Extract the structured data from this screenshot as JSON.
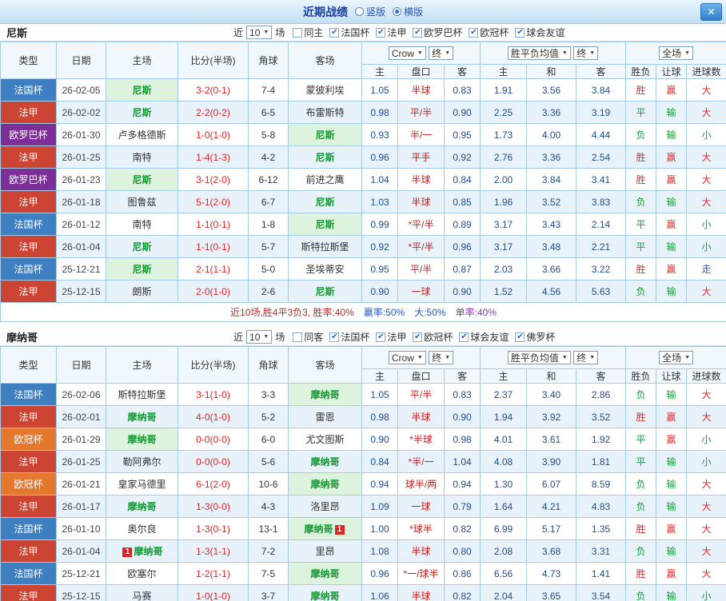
{
  "header": {
    "title": "近期战绩",
    "view_vertical": "竖版",
    "view_horizontal": "横版",
    "close_label": "✕"
  },
  "table": {
    "group_headers": [
      "类型",
      "日期",
      "主场",
      "比分(半场)",
      "角球",
      "客场"
    ],
    "sub_headers": [
      "主",
      "盘口",
      "客",
      "主",
      "和",
      "客",
      "胜负",
      "让球",
      "进球数"
    ],
    "selects": {
      "bookmaker": "Crow",
      "stage1": "终",
      "avg": "胜平负均值",
      "stage2": "终",
      "scope": "全场"
    },
    "near_label": "近",
    "games_count": "10",
    "games_suffix": "场"
  },
  "type_colors": {
    "法国杯": "#3d7fc1",
    "法甲": "#cc4433",
    "欧罗巴杯": "#7c3097",
    "欧冠杯": "#e4792e"
  },
  "result_colors": {
    "red": "#e02b2b",
    "green": "#13a039",
    "blue": "#2d5fd3"
  },
  "sections": [
    {
      "team": "尼斯",
      "checkboxes": [
        {
          "label": "同主",
          "checked": false
        },
        {
          "label": "法国杯",
          "checked": true
        },
        {
          "label": "法甲",
          "checked": true
        },
        {
          "label": "欧罗巴杯",
          "checked": true
        },
        {
          "label": "欧冠杯",
          "checked": true
        },
        {
          "label": "球会友谊",
          "checked": true
        }
      ],
      "rows": [
        {
          "type": "法国杯",
          "date": "26-02-05",
          "home": "尼斯",
          "home_team": true,
          "score": "3-2(0-1)",
          "corners": "7-4",
          "away": "蒙彼利埃",
          "away_team": false,
          "w_home": "1.05",
          "handicap": "半球",
          "w_away": "0.83",
          "avg_home": "1.91",
          "avg_draw": "3.56",
          "avg_away": "3.84",
          "outcome": {
            "t": "胜",
            "c": "red"
          },
          "let_result": {
            "t": "赢",
            "c": "red"
          },
          "goals": {
            "t": "大",
            "c": "red"
          }
        },
        {
          "type": "法甲",
          "date": "26-02-02",
          "home": "尼斯",
          "home_team": true,
          "score": "2-2(0-2)",
          "corners": "6-5",
          "away": "布雷斯特",
          "away_team": false,
          "w_home": "0.98",
          "handicap": "平/半",
          "w_away": "0.90",
          "avg_home": "2.25",
          "avg_draw": "3.36",
          "avg_away": "3.19",
          "outcome": {
            "t": "平",
            "c": "green"
          },
          "let_result": {
            "t": "输",
            "c": "green"
          },
          "goals": {
            "t": "大",
            "c": "red"
          }
        },
        {
          "type": "欧罗巴杯",
          "date": "26-01-30",
          "home": "卢多格德斯",
          "home_team": false,
          "score": "1-0(1-0)",
          "corners": "5-8",
          "away": "尼斯",
          "away_team": true,
          "w_home": "0.93",
          "handicap": "半/一",
          "w_away": "0.95",
          "avg_home": "1.73",
          "avg_draw": "4.00",
          "avg_away": "4.44",
          "outcome": {
            "t": "负",
            "c": "green"
          },
          "let_result": {
            "t": "输",
            "c": "green"
          },
          "goals": {
            "t": "小",
            "c": "green"
          }
        },
        {
          "type": "法甲",
          "date": "26-01-25",
          "home": "南特",
          "home_team": false,
          "score": "1-4(1-3)",
          "corners": "4-2",
          "away": "尼斯",
          "away_team": true,
          "w_home": "0.96",
          "handicap": "平手",
          "w_away": "0.92",
          "avg_home": "2.76",
          "avg_draw": "3.36",
          "avg_away": "2.54",
          "outcome": {
            "t": "胜",
            "c": "red"
          },
          "let_result": {
            "t": "赢",
            "c": "red"
          },
          "goals": {
            "t": "大",
            "c": "red"
          }
        },
        {
          "type": "欧罗巴杯",
          "date": "26-01-23",
          "home": "尼斯",
          "home_team": true,
          "score": "3-1(2-0)",
          "corners": "6-12",
          "away": "前进之鹰",
          "away_team": false,
          "w_home": "1.04",
          "handicap": "半球",
          "w_away": "0.84",
          "avg_home": "2.00",
          "avg_draw": "3.84",
          "avg_away": "3.41",
          "outcome": {
            "t": "胜",
            "c": "red"
          },
          "let_result": {
            "t": "赢",
            "c": "red"
          },
          "goals": {
            "t": "大",
            "c": "red"
          }
        },
        {
          "type": "法甲",
          "date": "26-01-18",
          "home": "图鲁兹",
          "home_team": false,
          "score": "5-1(2-0)",
          "corners": "6-7",
          "away": "尼斯",
          "away_team": true,
          "w_home": "1.03",
          "handicap": "半球",
          "w_away": "0.85",
          "avg_home": "1.96",
          "avg_draw": "3.52",
          "avg_away": "3.83",
          "outcome": {
            "t": "负",
            "c": "green"
          },
          "let_result": {
            "t": "输",
            "c": "green"
          },
          "goals": {
            "t": "大",
            "c": "red"
          }
        },
        {
          "type": "法国杯",
          "date": "26-01-12",
          "home": "南特",
          "home_team": false,
          "score": "1-1(0-1)",
          "corners": "1-8",
          "away": "尼斯",
          "away_team": true,
          "w_home": "0.99",
          "handicap": "*平/半",
          "w_away": "0.89",
          "avg_home": "3.17",
          "avg_draw": "3.43",
          "avg_away": "2.14",
          "outcome": {
            "t": "平",
            "c": "green"
          },
          "let_result": {
            "t": "赢",
            "c": "red"
          },
          "goals": {
            "t": "小",
            "c": "green"
          }
        },
        {
          "type": "法甲",
          "date": "26-01-04",
          "home": "尼斯",
          "home_team": true,
          "score": "1-1(0-1)",
          "corners": "5-7",
          "away": "斯特拉斯堡",
          "away_team": false,
          "w_home": "0.92",
          "handicap": "*平/半",
          "w_away": "0.96",
          "avg_home": "3.17",
          "avg_draw": "3.48",
          "avg_away": "2.21",
          "outcome": {
            "t": "平",
            "c": "green"
          },
          "let_result": {
            "t": "输",
            "c": "green"
          },
          "goals": {
            "t": "小",
            "c": "green"
          }
        },
        {
          "type": "法国杯",
          "date": "25-12-21",
          "home": "尼斯",
          "home_team": true,
          "score": "2-1(1-1)",
          "corners": "5-0",
          "away": "圣埃蒂安",
          "away_team": false,
          "w_home": "0.95",
          "handicap": "平/半",
          "w_away": "0.87",
          "avg_home": "2.03",
          "avg_draw": "3.66",
          "avg_away": "3.22",
          "outcome": {
            "t": "胜",
            "c": "red"
          },
          "let_result": {
            "t": "赢",
            "c": "red"
          },
          "goals": {
            "t": "走",
            "c": "blue"
          }
        },
        {
          "type": "法甲",
          "date": "25-12-15",
          "home": "朗斯",
          "home_team": false,
          "score": "2-0(1-0)",
          "corners": "2-6",
          "away": "尼斯",
          "away_team": true,
          "w_home": "0.90",
          "handicap": "一球",
          "w_away": "0.90",
          "avg_home": "1.52",
          "avg_draw": "4.56",
          "avg_away": "5.63",
          "outcome": {
            "t": "负",
            "c": "green"
          },
          "let_result": {
            "t": "输",
            "c": "green"
          },
          "goals": {
            "t": "大",
            "c": "red"
          }
        }
      ],
      "summary": [
        {
          "text": "近10场,胜4平3负3, 胜率:40%",
          "color": "#b03030"
        },
        {
          "text": "赢率:50%",
          "color": "#2757c4"
        },
        {
          "text": "大:50%",
          "color": "#2757c4"
        },
        {
          "text": "单率:40%",
          "color": "#9039b0"
        }
      ]
    },
    {
      "team": "摩纳哥",
      "checkboxes": [
        {
          "label": "同客",
          "checked": false
        },
        {
          "label": "法国杯",
          "checked": true
        },
        {
          "label": "法甲",
          "checked": true
        },
        {
          "label": "欧冠杯",
          "checked": true
        },
        {
          "label": "球会友谊",
          "checked": true
        },
        {
          "label": "佛罗杯",
          "checked": true
        }
      ],
      "rows": [
        {
          "type": "法国杯",
          "date": "26-02-06",
          "home": "斯特拉斯堡",
          "home_team": false,
          "score": "3-1(1-0)",
          "corners": "3-3",
          "away": "摩纳哥",
          "away_team": true,
          "w_home": "1.05",
          "handicap": "平/半",
          "w_away": "0.83",
          "avg_home": "2.37",
          "avg_draw": "3.40",
          "avg_away": "2.86",
          "outcome": {
            "t": "负",
            "c": "green"
          },
          "let_result": {
            "t": "输",
            "c": "green"
          },
          "goals": {
            "t": "大",
            "c": "red"
          }
        },
        {
          "type": "法甲",
          "date": "26-02-01",
          "home": "摩纳哥",
          "home_team": true,
          "score": "4-0(1-0)",
          "corners": "5-2",
          "away": "雷恩",
          "away_team": false,
          "w_home": "0.98",
          "handicap": "半球",
          "w_away": "0.90",
          "avg_home": "1.94",
          "avg_draw": "3.92",
          "avg_away": "3.52",
          "outcome": {
            "t": "胜",
            "c": "red"
          },
          "let_result": {
            "t": "赢",
            "c": "red"
          },
          "goals": {
            "t": "大",
            "c": "red"
          }
        },
        {
          "type": "欧冠杯",
          "date": "26-01-29",
          "home": "摩纳哥",
          "home_team": true,
          "score": "0-0(0-0)",
          "corners": "6-0",
          "away": "尤文图斯",
          "away_team": false,
          "w_home": "0.90",
          "handicap": "*半球",
          "w_away": "0.98",
          "avg_home": "4.01",
          "avg_draw": "3.61",
          "avg_away": "1.92",
          "outcome": {
            "t": "平",
            "c": "green"
          },
          "let_result": {
            "t": "赢",
            "c": "red"
          },
          "goals": {
            "t": "小",
            "c": "green"
          }
        },
        {
          "type": "法甲",
          "date": "26-01-25",
          "home": "勒阿弗尔",
          "home_team": false,
          "score": "0-0(0-0)",
          "corners": "5-6",
          "away": "摩纳哥",
          "away_team": true,
          "w_home": "0.84",
          "handicap": "*半/一",
          "w_away": "1.04",
          "avg_home": "4.08",
          "avg_draw": "3.90",
          "avg_away": "1.81",
          "outcome": {
            "t": "平",
            "c": "green"
          },
          "let_result": {
            "t": "输",
            "c": "green"
          },
          "goals": {
            "t": "小",
            "c": "green"
          }
        },
        {
          "type": "欧冠杯",
          "date": "26-01-21",
          "home": "皇家马德里",
          "home_team": false,
          "score": "6-1(2-0)",
          "corners": "10-6",
          "away": "摩纳哥",
          "away_team": true,
          "w_home": "0.94",
          "handicap": "球半/两",
          "w_away": "0.94",
          "avg_home": "1.30",
          "avg_draw": "6.07",
          "avg_away": "8.59",
          "outcome": {
            "t": "负",
            "c": "green"
          },
          "let_result": {
            "t": "输",
            "c": "green"
          },
          "goals": {
            "t": "大",
            "c": "red"
          }
        },
        {
          "type": "法甲",
          "date": "26-01-17",
          "home": "摩纳哥",
          "home_team": true,
          "score": "1-3(0-0)",
          "corners": "4-3",
          "away": "洛里昂",
          "away_team": false,
          "w_home": "1.09",
          "handicap": "一球",
          "w_away": "0.79",
          "avg_home": "1.64",
          "avg_draw": "4.21",
          "avg_away": "4.83",
          "outcome": {
            "t": "负",
            "c": "green"
          },
          "let_result": {
            "t": "输",
            "c": "green"
          },
          "goals": {
            "t": "大",
            "c": "red"
          }
        },
        {
          "type": "法国杯",
          "date": "26-01-10",
          "home": "奥尔良",
          "home_team": false,
          "score": "1-3(0-1)",
          "corners": "13-1",
          "away": "摩纳哥",
          "away_team": true,
          "away_card": "1",
          "w_home": "1.00",
          "handicap": "*球半",
          "w_away": "0.82",
          "avg_home": "6.99",
          "avg_draw": "5.17",
          "avg_away": "1.35",
          "outcome": {
            "t": "胜",
            "c": "red"
          },
          "let_result": {
            "t": "赢",
            "c": "red"
          },
          "goals": {
            "t": "大",
            "c": "red"
          }
        },
        {
          "type": "法甲",
          "date": "26-01-04",
          "home": "摩纳哥",
          "home_team": true,
          "home_card": "1",
          "score": "1-3(1-1)",
          "corners": "7-2",
          "away": "里昂",
          "away_team": false,
          "w_home": "1.08",
          "handicap": "半球",
          "w_away": "0.80",
          "avg_home": "2.08",
          "avg_draw": "3.68",
          "avg_away": "3.31",
          "outcome": {
            "t": "负",
            "c": "green"
          },
          "let_result": {
            "t": "输",
            "c": "green"
          },
          "goals": {
            "t": "大",
            "c": "red"
          }
        },
        {
          "type": "法国杯",
          "date": "25-12-21",
          "home": "欧塞尔",
          "home_team": false,
          "score": "1-2(1-1)",
          "corners": "7-5",
          "away": "摩纳哥",
          "away_team": true,
          "w_home": "0.96",
          "handicap": "*一/球半",
          "w_away": "0.86",
          "avg_home": "6.56",
          "avg_draw": "4.73",
          "avg_away": "1.41",
          "outcome": {
            "t": "胜",
            "c": "red"
          },
          "let_result": {
            "t": "赢",
            "c": "red"
          },
          "goals": {
            "t": "大",
            "c": "red"
          }
        },
        {
          "type": "法甲",
          "date": "25-12-15",
          "home": "马赛",
          "home_team": false,
          "score": "1-0(1-0)",
          "corners": "3-7",
          "away": "摩纳哥",
          "away_team": true,
          "w_home": "1.06",
          "handicap": "半球",
          "w_away": "0.82",
          "avg_home": "2.04",
          "avg_draw": "3.65",
          "avg_away": "3.54",
          "outcome": {
            "t": "负",
            "c": "green"
          },
          "let_result": {
            "t": "输",
            "c": "green"
          },
          "goals": {
            "t": "小",
            "c": "green"
          }
        }
      ]
    }
  ]
}
